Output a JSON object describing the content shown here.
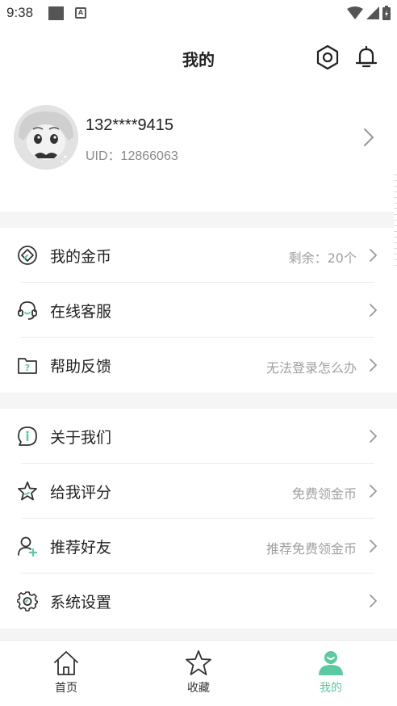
{
  "status_bar": {
    "time": "9:38",
    "a_icon": "A"
  },
  "header": {
    "title": "我的",
    "settings_icon": "hexagon-settings-icon",
    "bell_icon": "bell-icon"
  },
  "profile": {
    "phone": "132****9415",
    "uid": "UID：12866063"
  },
  "menu_group_1": [
    {
      "label": "我的金币",
      "hint": "剩余：20个",
      "icon": "coin-icon"
    },
    {
      "label": "在线客服",
      "hint": "",
      "icon": "headset-icon"
    },
    {
      "label": "帮助反馈",
      "hint": "无法登录怎么办",
      "icon": "help-folder-icon"
    }
  ],
  "menu_group_2": [
    {
      "label": "关于我们",
      "hint": "",
      "icon": "info-icon"
    },
    {
      "label": "给我评分",
      "hint": "免费领金币",
      "icon": "star-icon"
    },
    {
      "label": "推荐好友",
      "hint": "推荐免费领金币",
      "icon": "add-friend-icon"
    },
    {
      "label": "系统设置",
      "hint": "",
      "icon": "gear-icon"
    }
  ],
  "tabbar": [
    {
      "label": "首页",
      "icon": "home-icon",
      "active": false
    },
    {
      "label": "收藏",
      "icon": "star-icon",
      "active": false
    },
    {
      "label": "我的",
      "icon": "user-icon",
      "active": true
    }
  ],
  "colors": {
    "accent": "#5ccaa0",
    "hint_text": "#a0a0a0",
    "separator": "#f5f5f5"
  }
}
